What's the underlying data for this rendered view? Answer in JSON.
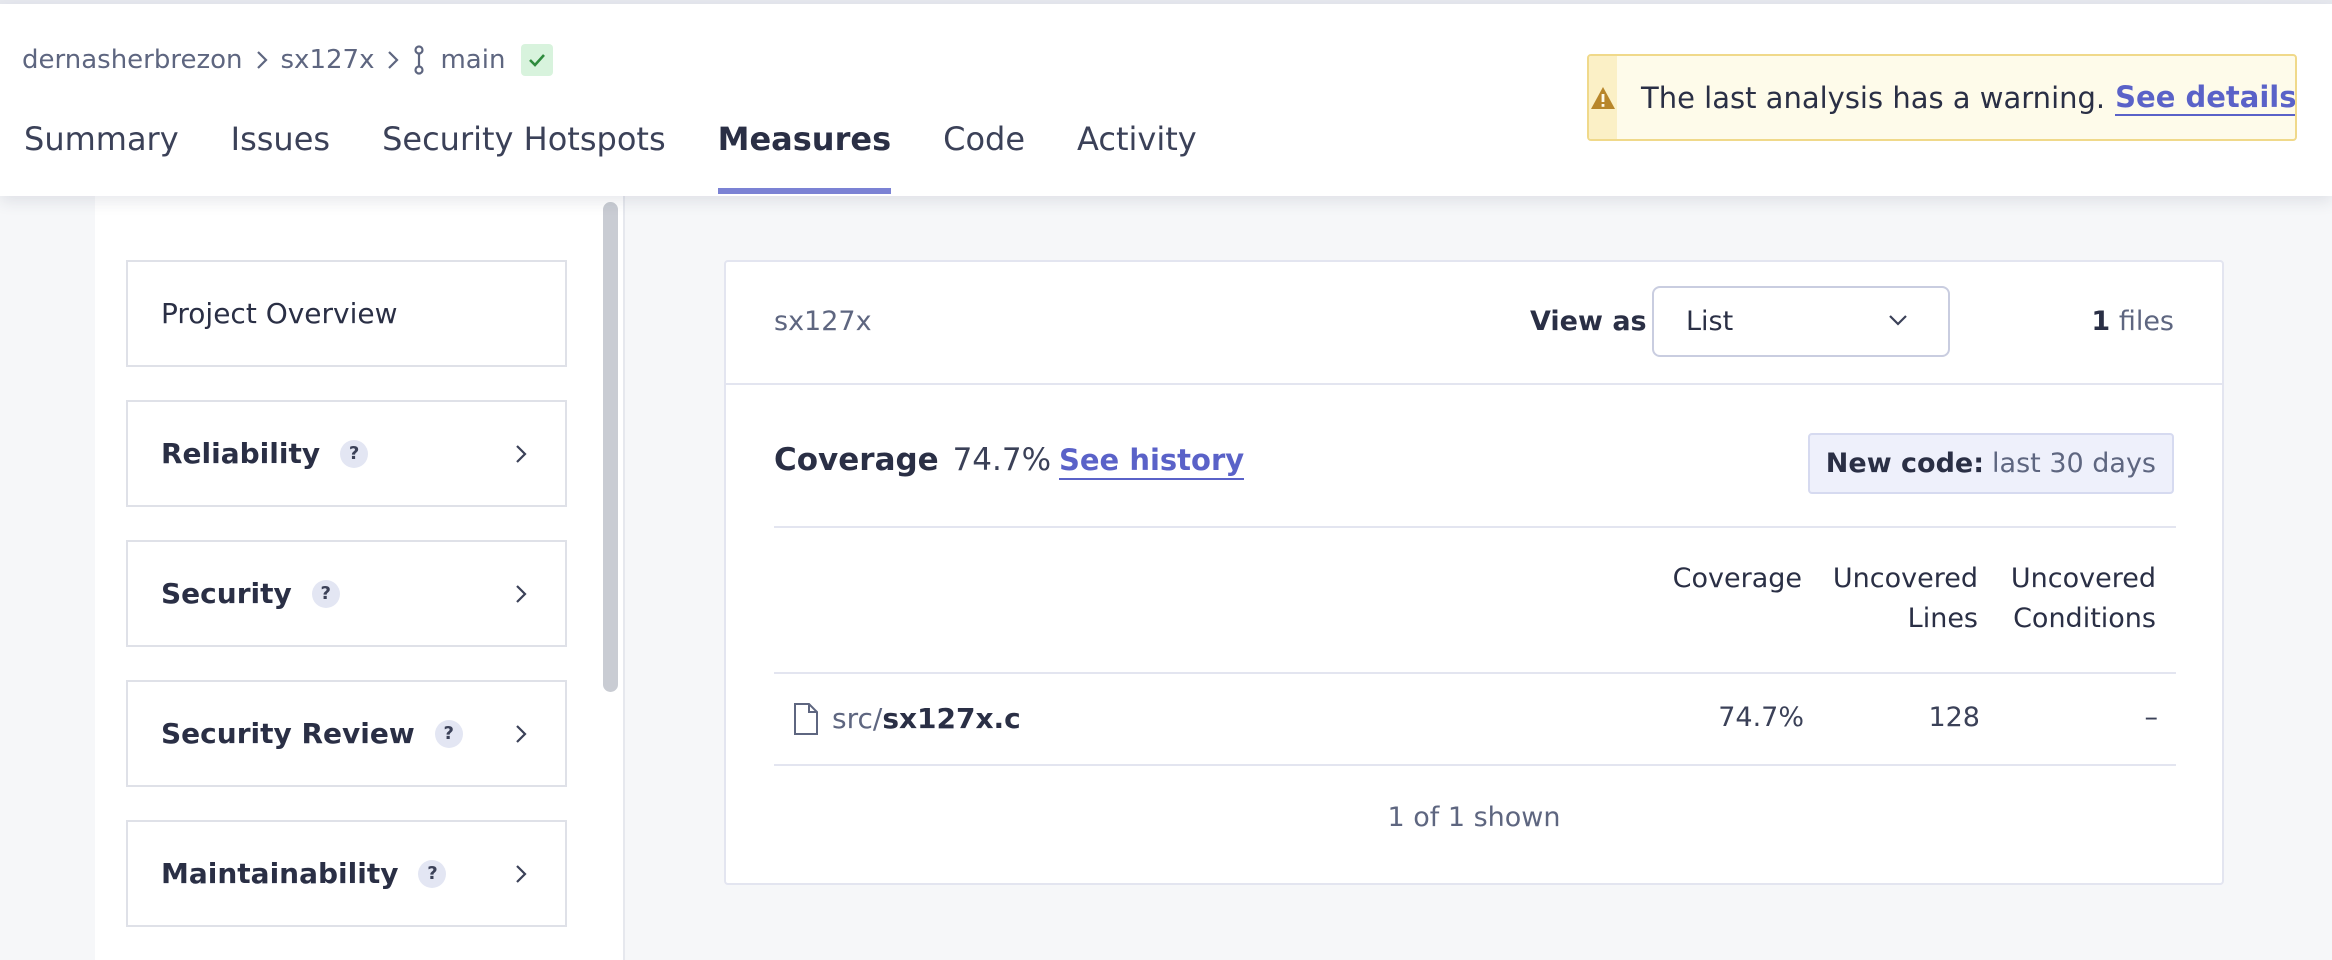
{
  "breadcrumb": {
    "organization": "dernasherbrezon",
    "project": "sx127x",
    "branch": "main"
  },
  "tabs": [
    {
      "label": "Summary",
      "active": false
    },
    {
      "label": "Issues",
      "active": false
    },
    {
      "label": "Security Hotspots",
      "active": false
    },
    {
      "label": "Measures",
      "active": true
    },
    {
      "label": "Code",
      "active": false
    },
    {
      "label": "Activity",
      "active": false
    }
  ],
  "warning": {
    "text": "The last analysis has a warning.",
    "link": "See details"
  },
  "sidebar": {
    "items": [
      {
        "label": "Project Overview",
        "help": false
      },
      {
        "label": "Reliability",
        "help": true
      },
      {
        "label": "Security",
        "help": true
      },
      {
        "label": "Security Review",
        "help": true
      },
      {
        "label": "Maintainability",
        "help": true
      }
    ],
    "help_glyph": "?"
  },
  "main": {
    "project_key": "sx127x",
    "view_as_label": "View as",
    "view_as_value": "List",
    "files_count": "1",
    "files_label": "files",
    "measure_name": "Coverage",
    "measure_value": "74.7%",
    "history_link": "See history",
    "new_code_label": "New code:",
    "new_code_value": "last 30 days",
    "columns": [
      {
        "line1": "Coverage",
        "line2": ""
      },
      {
        "line1": "Uncovered",
        "line2": "Lines"
      },
      {
        "line1": "Uncovered",
        "line2": "Conditions"
      }
    ],
    "rows": [
      {
        "path": "src/",
        "filename": "sx127x.c",
        "coverage": "74.7%",
        "uncovered_lines": "128",
        "uncovered_conditions": "–"
      }
    ],
    "shown_text": "1 of 1 shown"
  },
  "colors": {
    "accent": "#5a62c8",
    "tab_underline": "#7b82d4",
    "success": "#2e8b3d",
    "warning": "#b8862a"
  }
}
